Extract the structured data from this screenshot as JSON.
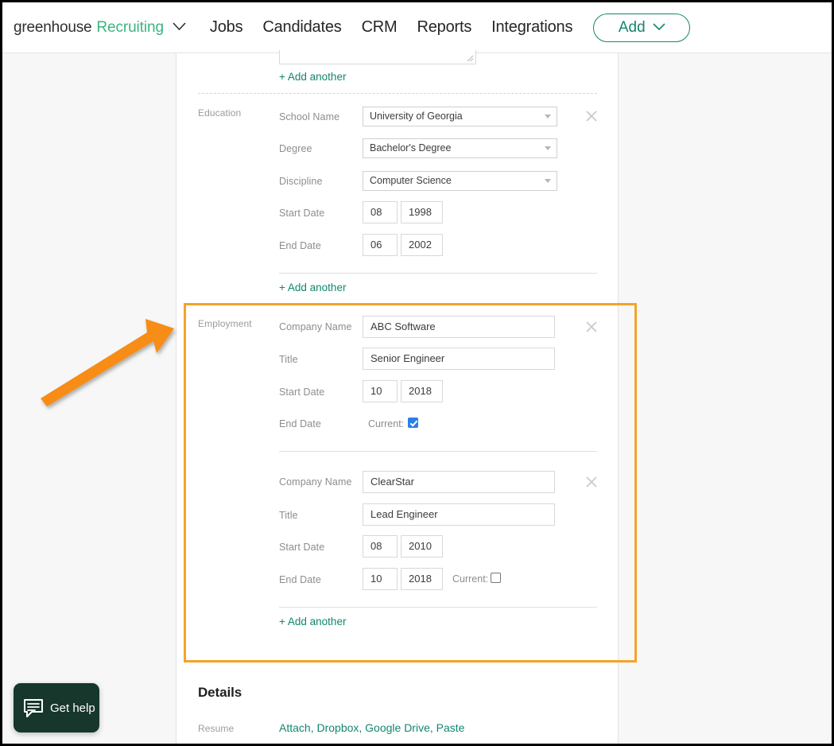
{
  "header": {
    "brand_primary": "greenhouse",
    "brand_secondary": "Recruiting",
    "nav": [
      {
        "label": "Jobs"
      },
      {
        "label": "Candidates"
      },
      {
        "label": "CRM"
      },
      {
        "label": "Reports"
      },
      {
        "label": "Integrations"
      }
    ],
    "add_button": "Add",
    "accent_green": "#13866f",
    "brand_green": "#3ab57e"
  },
  "form": {
    "add_another": "+ Add another",
    "education": {
      "section_label": "Education",
      "fields": {
        "school_name_label": "School Name",
        "school_name_value": "University of Georgia",
        "degree_label": "Degree",
        "degree_value": "Bachelor's Degree",
        "discipline_label": "Discipline",
        "discipline_value": "Computer Science",
        "start_date_label": "Start Date",
        "start_month": "08",
        "start_year": "1998",
        "end_date_label": "End Date",
        "end_month": "06",
        "end_year": "2002"
      }
    },
    "employment": {
      "section_label": "Employment",
      "entries": [
        {
          "company_name_label": "Company Name",
          "company_name_value": "ABC Software",
          "title_label": "Title",
          "title_value": "Senior Engineer",
          "start_date_label": "Start Date",
          "start_month": "10",
          "start_year": "2018",
          "end_date_label": "End Date",
          "current_label": "Current:",
          "current_checked": true,
          "end_month": "",
          "end_year": ""
        },
        {
          "company_name_label": "Company Name",
          "company_name_value": "ClearStar",
          "title_label": "Title",
          "title_value": "Lead Engineer",
          "start_date_label": "Start Date",
          "start_month": "08",
          "start_year": "2010",
          "end_date_label": "End Date",
          "current_label": "Current:",
          "current_checked": false,
          "end_month": "10",
          "end_year": "2018"
        }
      ]
    }
  },
  "details": {
    "heading": "Details",
    "resume_label": "Resume",
    "resume_links": "Attach, Dropbox, Google Drive, Paste"
  },
  "annotation": {
    "highlight_color": "#f5a329",
    "arrow_color": "#f78c14"
  },
  "widget": {
    "get_help_label": "Get help"
  }
}
